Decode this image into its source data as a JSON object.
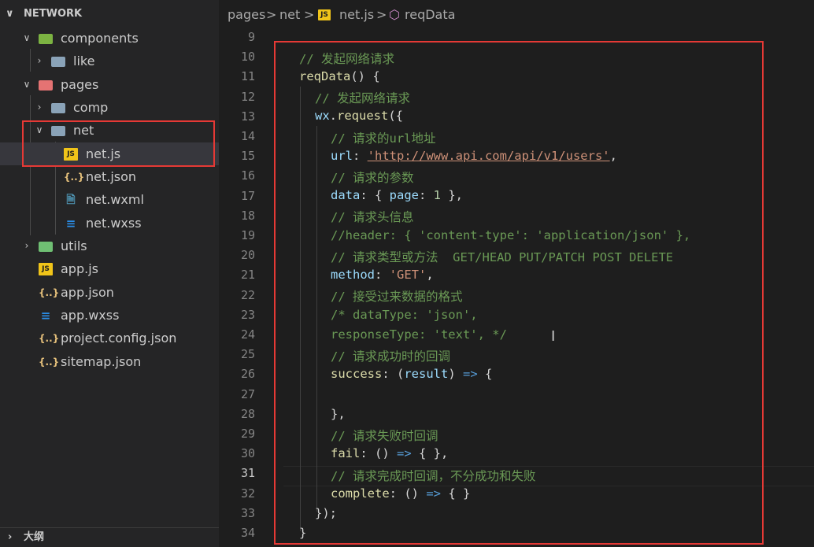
{
  "sidebar": {
    "title": "NETWORK",
    "outline_title": "大纲",
    "items": [
      {
        "label": "components"
      },
      {
        "label": "like"
      },
      {
        "label": "pages"
      },
      {
        "label": "comp"
      },
      {
        "label": "net"
      },
      {
        "label": "net.js",
        "icon_text": "JS"
      },
      {
        "label": "net.json",
        "icon_text": "{..}"
      },
      {
        "label": "net.wxml"
      },
      {
        "label": "net.wxss"
      },
      {
        "label": "utils"
      },
      {
        "label": "app.js",
        "icon_text": "JS"
      },
      {
        "label": "app.json",
        "icon_text": "{..}"
      },
      {
        "label": "app.wxss"
      },
      {
        "label": "project.config.json",
        "icon_text": "{..}"
      },
      {
        "label": "sitemap.json",
        "icon_text": "{..}"
      }
    ]
  },
  "breadcrumb": {
    "parts": [
      "pages",
      "net",
      "net.js",
      "reqData"
    ],
    "js_badge": "JS",
    "sep": ">"
  },
  "editor": {
    "active_line": 31,
    "line_numbers": [
      "9",
      "10",
      "11",
      "12",
      "13",
      "14",
      "15",
      "16",
      "17",
      "18",
      "19",
      "20",
      "21",
      "22",
      "23",
      "24",
      "25",
      "26",
      "27",
      "28",
      "29",
      "30",
      "31",
      "32",
      "33",
      "34"
    ],
    "lines": {
      "l10": "// 发起网络请求",
      "l11a": "reqData",
      "l11b": "() {",
      "l12": "// 发起网络请求",
      "l13a": "wx",
      "l13b": ".",
      "l13c": "request",
      "l13d": "({",
      "l14": "// 请求的url地址",
      "l15a": "url",
      "l15b": ": ",
      "l15c": "'http://www.api.com/api/v1/users'",
      "l15d": ",",
      "l16": "// 请求的参数",
      "l17a": "data",
      "l17b": ": { ",
      "l17c": "page",
      "l17d": ": ",
      "l17e": "1",
      "l17f": " },",
      "l18": "// 请求头信息",
      "l19": "//header: { 'content-type': 'application/json' },",
      "l20": "// 请求类型或方法  GET/HEAD PUT/PATCH POST DELETE",
      "l21a": "method",
      "l21b": ": ",
      "l21c": "'GET'",
      "l21d": ",",
      "l22": "// 接受过来数据的格式",
      "l23": "/* dataType: 'json',",
      "l24": "responseType: 'text', */",
      "l25": "// 请求成功时的回调",
      "l26a": "success",
      "l26b": ": (",
      "l26c": "result",
      "l26d": ") ",
      "l26e": "=>",
      "l26f": " {",
      "l28": "},",
      "l29": "// 请求失败时回调",
      "l30a": "fail",
      "l30b": ": () ",
      "l30c": "=>",
      "l30d": " { },",
      "l31": "// 请求完成时回调，不分成功和失败",
      "l32a": "complete",
      "l32b": ": () ",
      "l32c": "=>",
      "l32d": " { }",
      "l33": "});",
      "l34": "}"
    }
  },
  "colors": {
    "highlight_box": "#e53935",
    "comment": "#6a9955",
    "string": "#ce9178",
    "property": "#9cdcfe",
    "function": "#dcdcaa"
  }
}
